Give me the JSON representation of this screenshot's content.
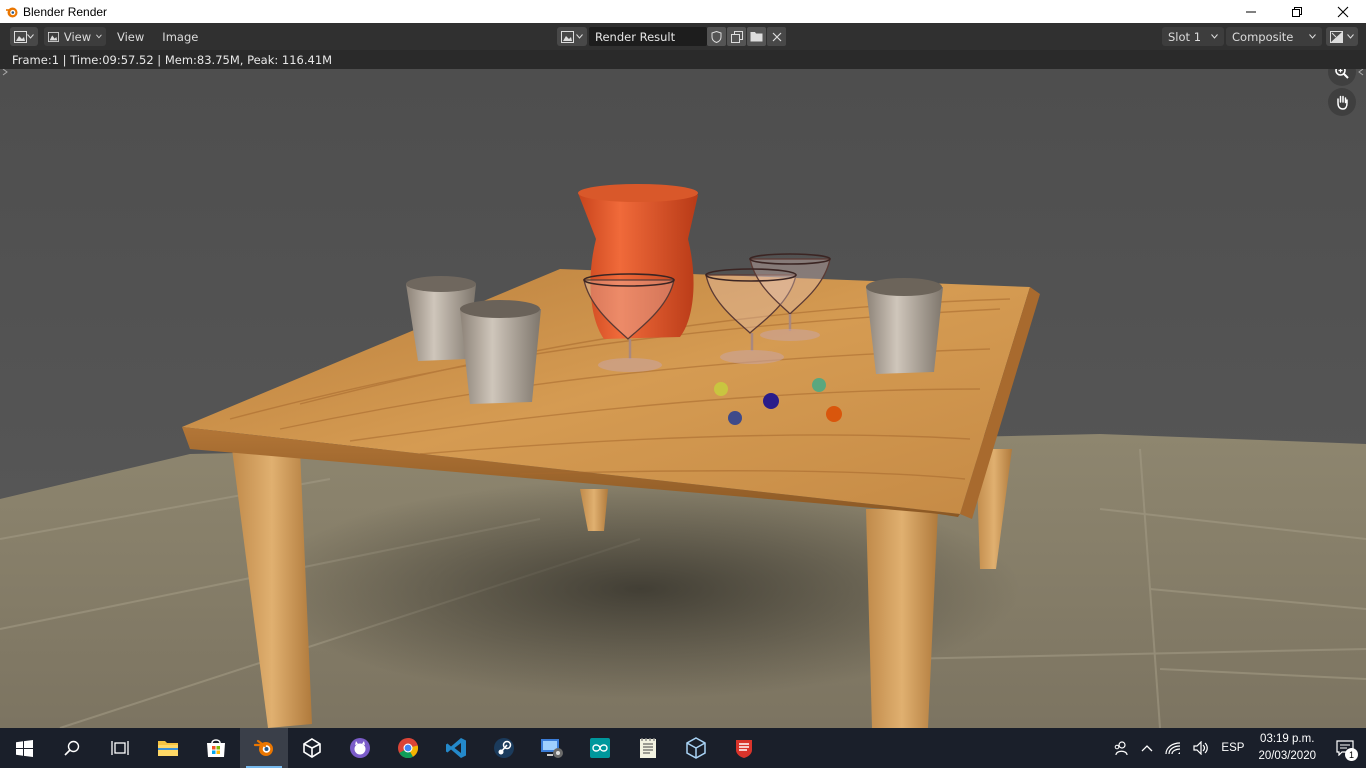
{
  "window": {
    "title": "Blender Render"
  },
  "header": {
    "view_dropdown_label": "View",
    "menu": [
      {
        "label": "View"
      },
      {
        "label": "Image"
      }
    ],
    "image_name": "Render Result",
    "slot_label": "Slot 1",
    "layer_label": "Composite"
  },
  "infobar": {
    "text": "Frame:1 | Time:09:57.52 | Mem:83.75M, Peak: 116.41M"
  },
  "render": {
    "description_icons": [
      "zoom-icon",
      "hand-pan-icon"
    ]
  },
  "taskbar": {
    "apps": [
      "start",
      "search",
      "task-view",
      "blender",
      "unity",
      "github-desktop",
      "chrome",
      "vscode",
      "steam",
      "remote-desktop",
      "arduino",
      "notepad",
      "virtualbox",
      "wps-office"
    ],
    "language": "ESP",
    "time": "03:19 p.m.",
    "date": "20/03/2020",
    "notification_count": "1"
  },
  "colors": {
    "blender_header": "#303030",
    "taskbar": "#1a1f2a",
    "accent": "#76b9ed",
    "vase": "#e0552a",
    "table_wood": "#c98f45"
  }
}
